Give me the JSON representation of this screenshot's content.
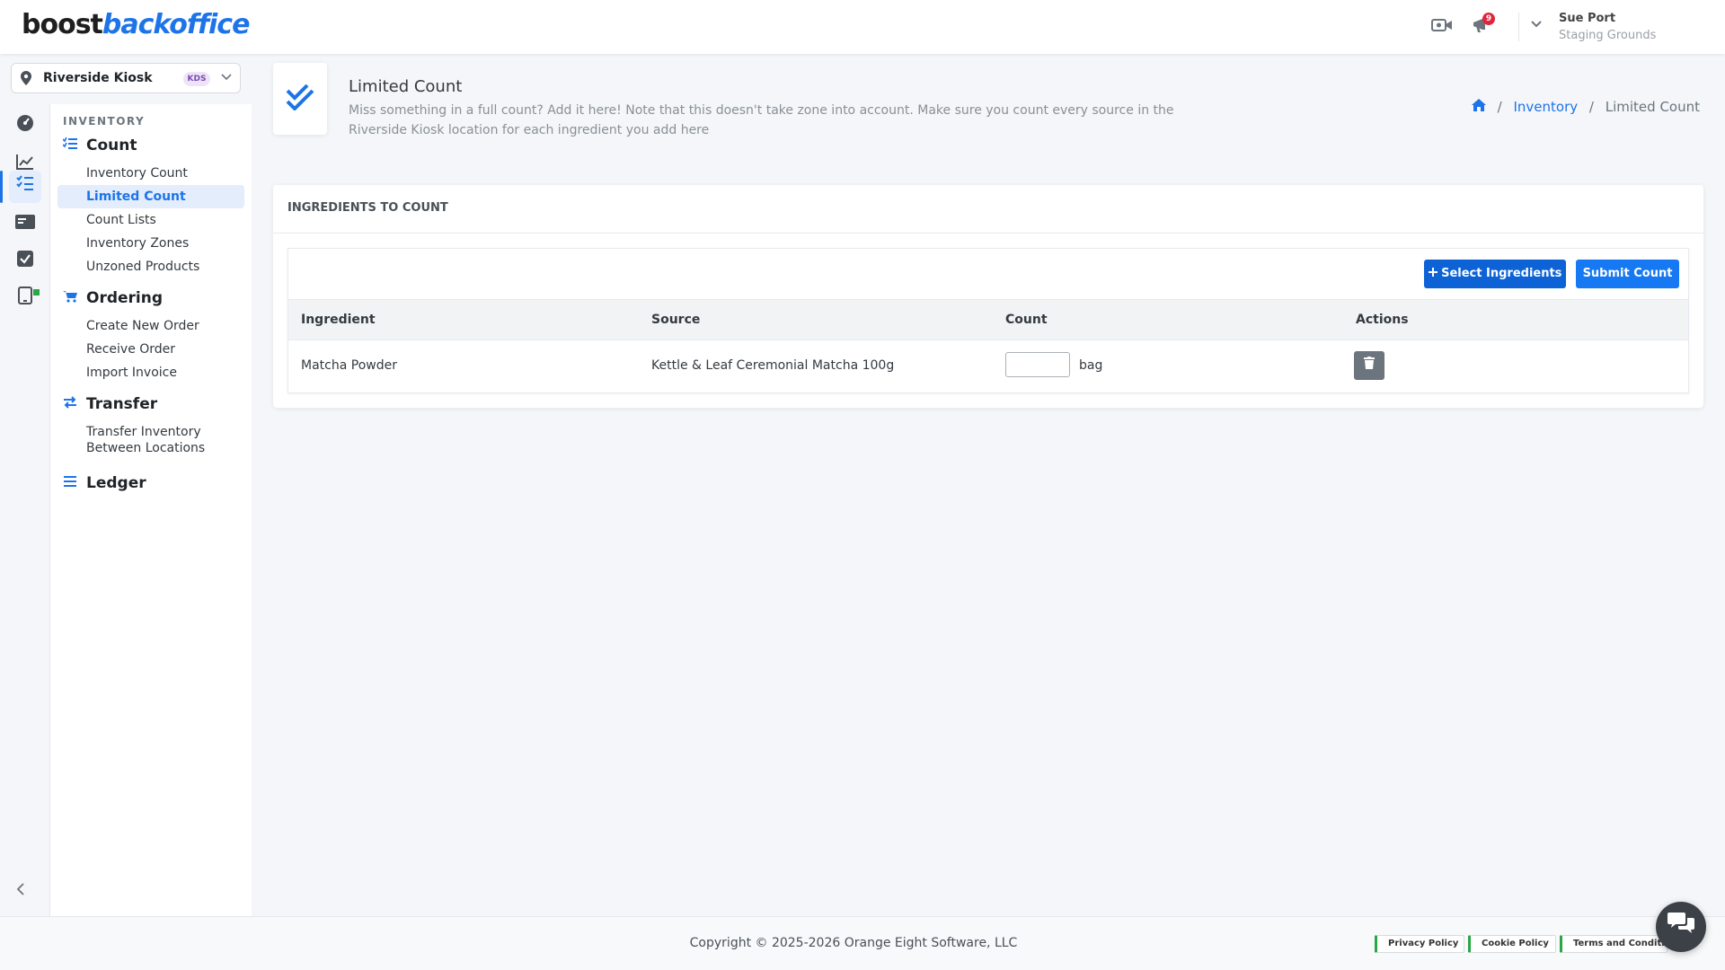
{
  "app": {
    "logo_part1": "boost",
    "logo_part2": "backoffice"
  },
  "header": {
    "notifications_count": "9",
    "user_name": "Sue Port",
    "user_org": "Staging Grounds"
  },
  "location": {
    "name": "Riverside Kiosk",
    "badge": "KDS"
  },
  "sidebar": {
    "section_label": "INVENTORY",
    "groups": [
      {
        "label": "Count",
        "items": [
          "Inventory Count",
          "Limited Count",
          "Count Lists",
          "Inventory Zones",
          "Unzoned Products"
        ]
      },
      {
        "label": "Ordering",
        "items": [
          "Create New Order",
          "Receive Order",
          "Import Invoice"
        ]
      },
      {
        "label": "Transfer",
        "items": [
          "Transfer Inventory Between Locations"
        ]
      },
      {
        "label": "Ledger",
        "items": []
      }
    ],
    "active_item": "Limited Count"
  },
  "page": {
    "title": "Limited Count",
    "description": "Miss something in a full count? Add it here! Note that this doesn't take zone into account. Make sure you count every source in the Riverside Kiosk location for each ingredient you add here"
  },
  "breadcrumb": {
    "items": [
      "Inventory",
      "Limited Count"
    ]
  },
  "card": {
    "title": "INGREDIENTS TO COUNT",
    "select_button": "Select Ingredients",
    "submit_button": "Submit Count",
    "columns": [
      "Ingredient",
      "Source",
      "Count",
      "Actions"
    ],
    "rows": [
      {
        "ingredient": "Matcha Powder",
        "source": "Kettle & Leaf Ceremonial Matcha 100g",
        "count": "",
        "unit": "bag"
      }
    ]
  },
  "footer": {
    "copyright": "Copyright © 2025-2026 Orange Eight Software, LLC",
    "links": [
      "Privacy Policy",
      "Cookie Policy",
      "Terms and Conditions"
    ]
  }
}
